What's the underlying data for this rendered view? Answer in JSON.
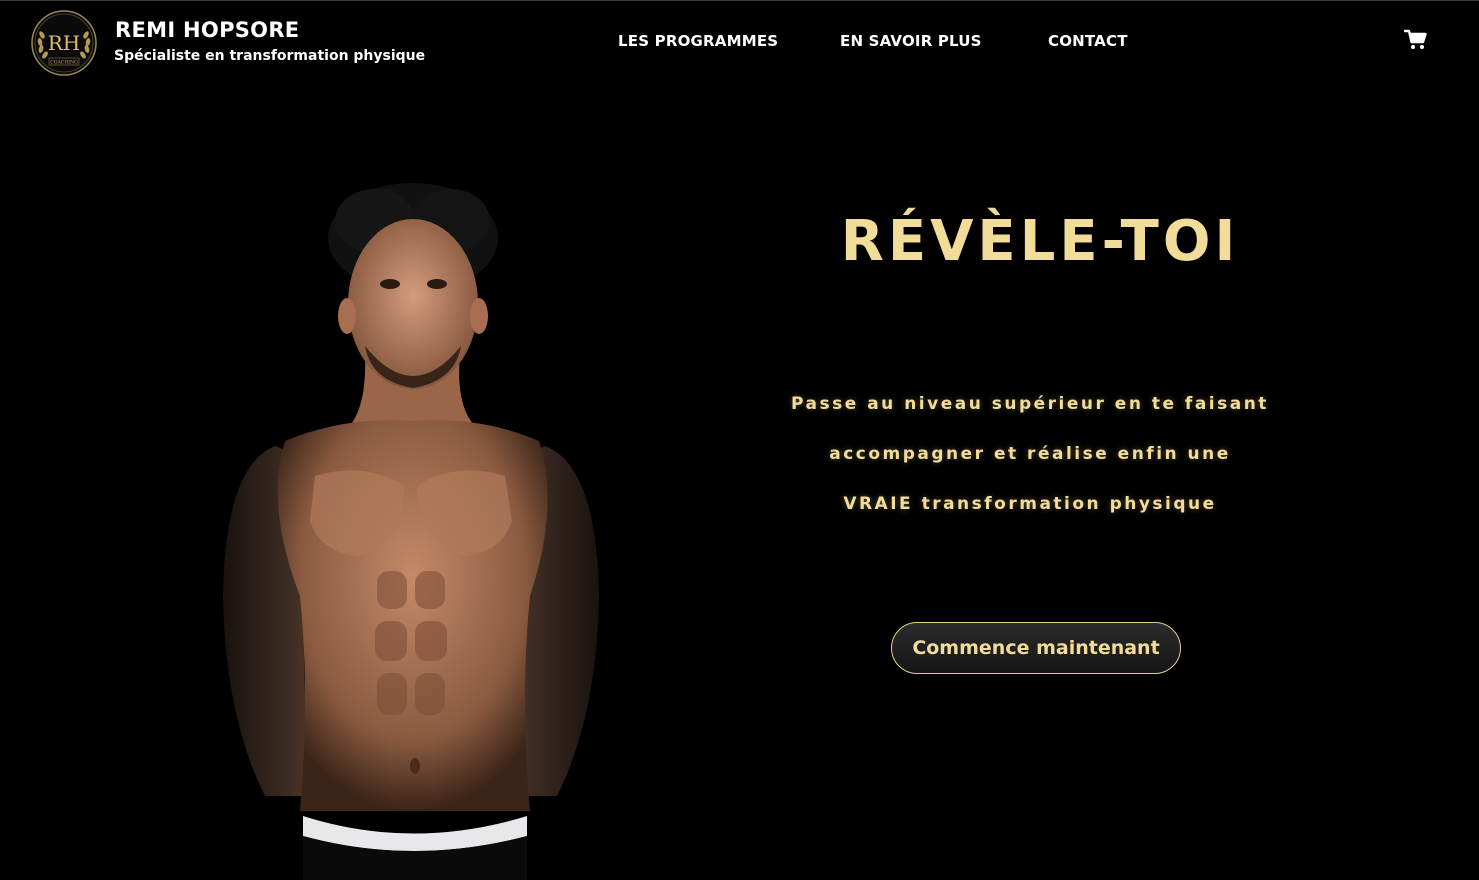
{
  "header": {
    "logo": {
      "monogram": "RH",
      "subtitle": "COACHING"
    },
    "brand_name": "REMI HOPSORE",
    "tagline": "Spécialiste en transformation physique",
    "nav": [
      {
        "label": "LES PROGRAMMES"
      },
      {
        "label": "EN SAVOIR PLUS"
      },
      {
        "label": "CONTACT"
      }
    ],
    "cart_icon": "shopping-cart-icon"
  },
  "hero": {
    "title": "RÉVÈLE-TOI",
    "text_lines": [
      "Passe au niveau supérieur en te faisant",
      "accompagner et réalise enfin une",
      "VRAIE transformation physique"
    ],
    "cta_label": "Commence maintenant",
    "image": "shirtless-man-portrait"
  },
  "colors": {
    "background": "#000000",
    "gold": "#f2dc9a",
    "gold_border": "#e8cf88",
    "nav_text": "#ffffff"
  }
}
